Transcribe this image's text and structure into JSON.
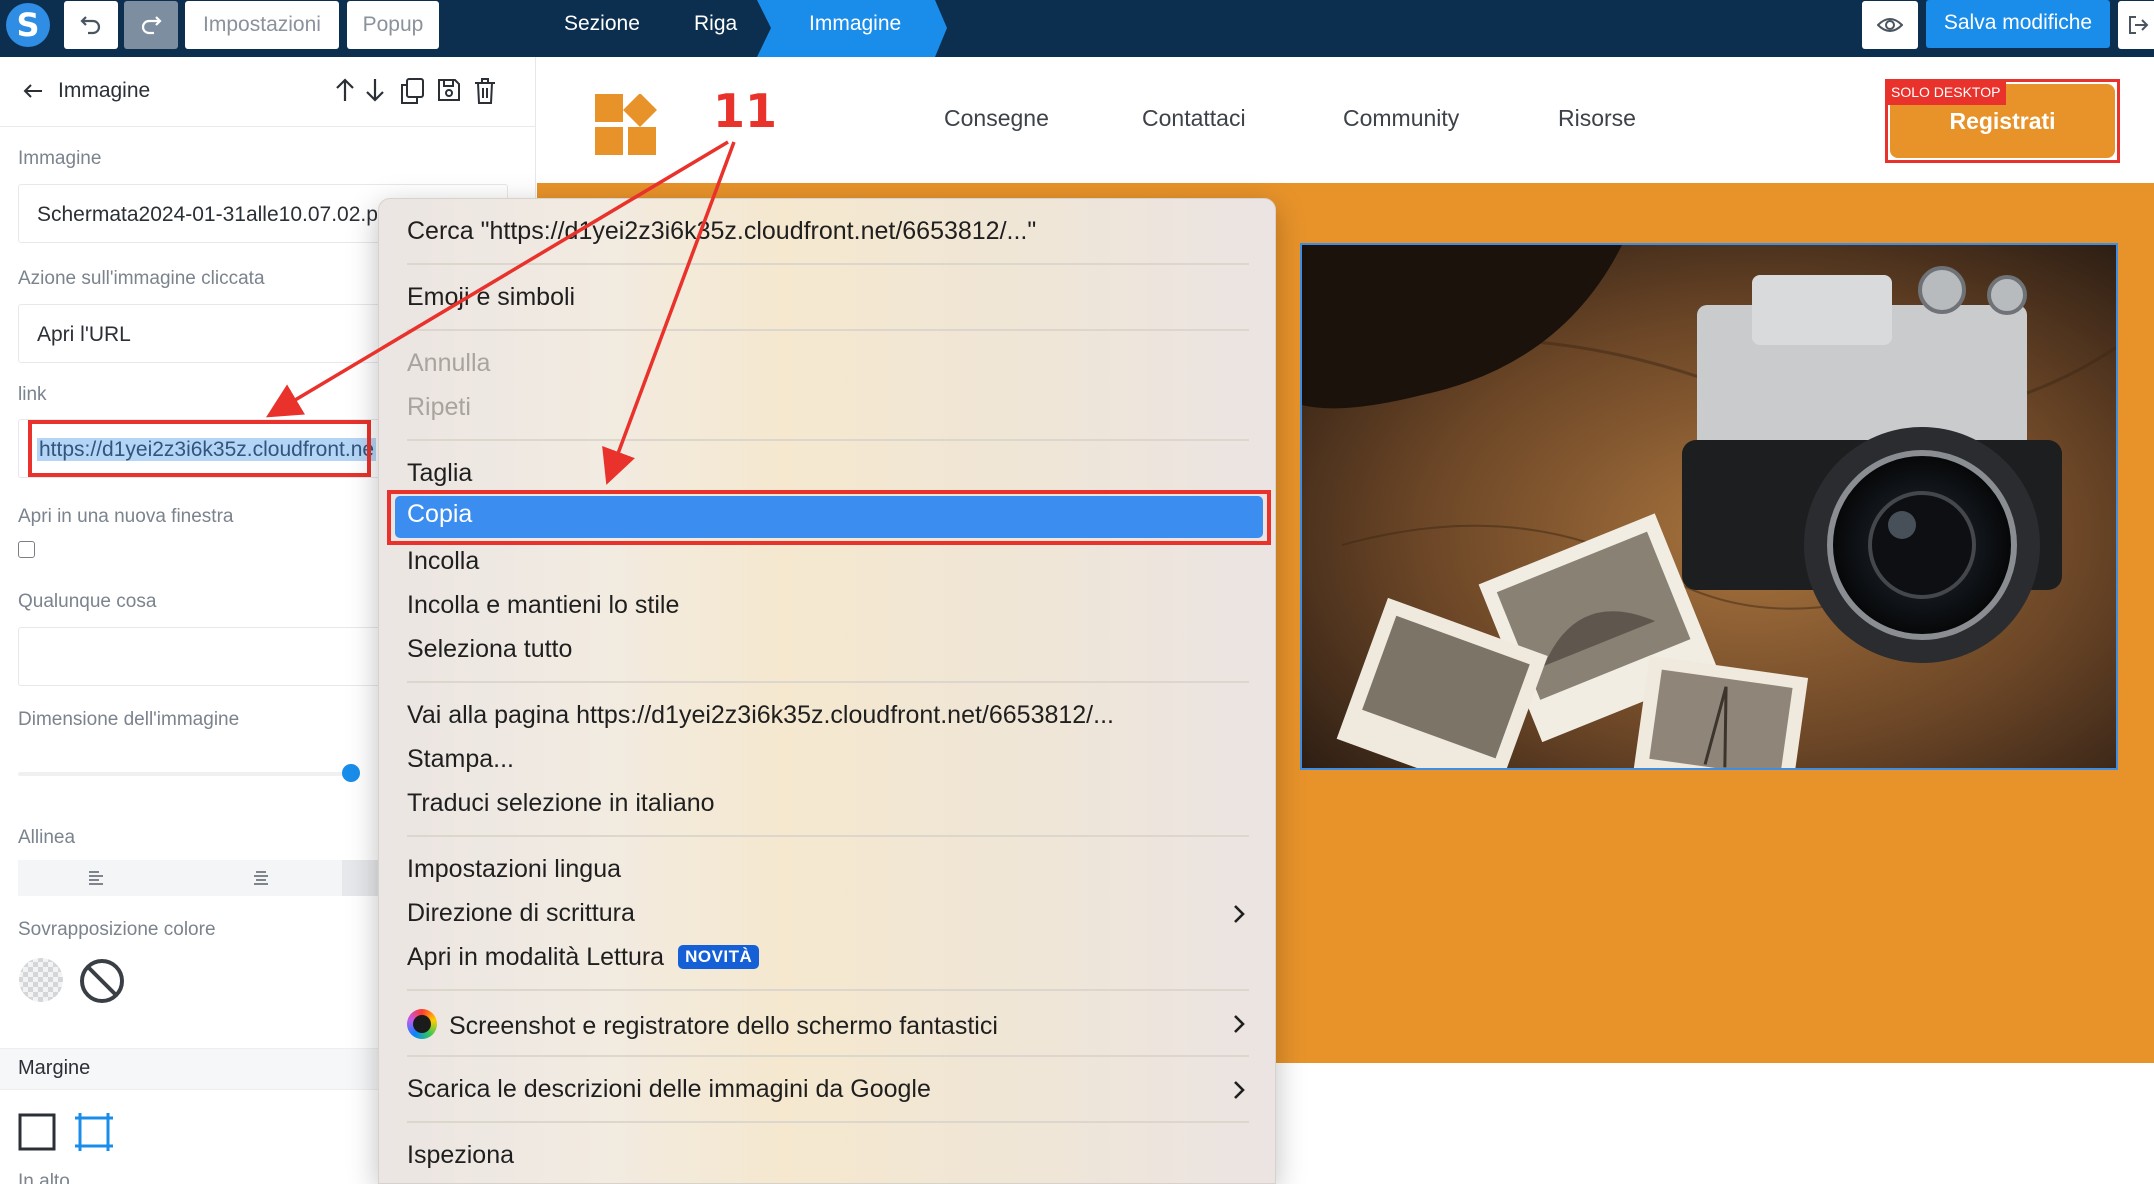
{
  "toolbar": {
    "settings_label": "Impostazioni",
    "popup_label": "Popup",
    "breadcrumb": [
      "Sezione",
      "Riga",
      "Immagine"
    ],
    "save_label": "Salva modifiche"
  },
  "panel": {
    "title": "Immagine",
    "image_label": "Immagine",
    "image_value": "Schermata2024-01-31alle10.07.02.p",
    "action_label": "Azione sull'immagine cliccata",
    "action_value": "Apri l'URL",
    "link_label": "link",
    "link_value": "https://d1yei2z3i6k35z.cloudfront.ne",
    "new_window_label": "Apri in una nuova finestra",
    "anything_label": "Qualunque cosa",
    "size_label": "Dimensione dell'immagine",
    "size_value": 0.99,
    "align_label": "Allinea",
    "overlay_label": "Sovrapposizione colore",
    "margin_label": "Margine",
    "top_label": "In alto"
  },
  "site": {
    "nav": [
      "Consegne",
      "Contattaci",
      "Community",
      "Risorse"
    ],
    "badge": "SOLO DESKTOP",
    "cta": "Registrati",
    "brand_color": "#e8932a"
  },
  "annotation": {
    "step": "11",
    "color": "#e8322b"
  },
  "context_menu": {
    "search": "Cerca \"https://d1yei2z3i6k35z.cloudfront.net/6653812/...\"",
    "emoji": "Emoji e simboli",
    "undo": "Annulla",
    "redo": "Ripeti",
    "cut": "Taglia",
    "copy": "Copia",
    "paste": "Incolla",
    "paste_style": "Incolla e mantieni lo stile",
    "select_all": "Seleziona tutto",
    "goto": "Vai alla pagina https://d1yei2z3i6k35z.cloudfront.net/6653812/...",
    "print": "Stampa...",
    "translate": "Traduci selezione in italiano",
    "lang_settings": "Impostazioni lingua",
    "writing_dir": "Direzione di scrittura",
    "reader_mode": "Apri in modalità Lettura",
    "new_badge": "NOVITÀ",
    "screenshot_ext": "Screenshot e registratore dello schermo fantastici",
    "google_desc": "Scarica le descrizioni delle immagini da Google",
    "inspect": "Ispeziona"
  }
}
